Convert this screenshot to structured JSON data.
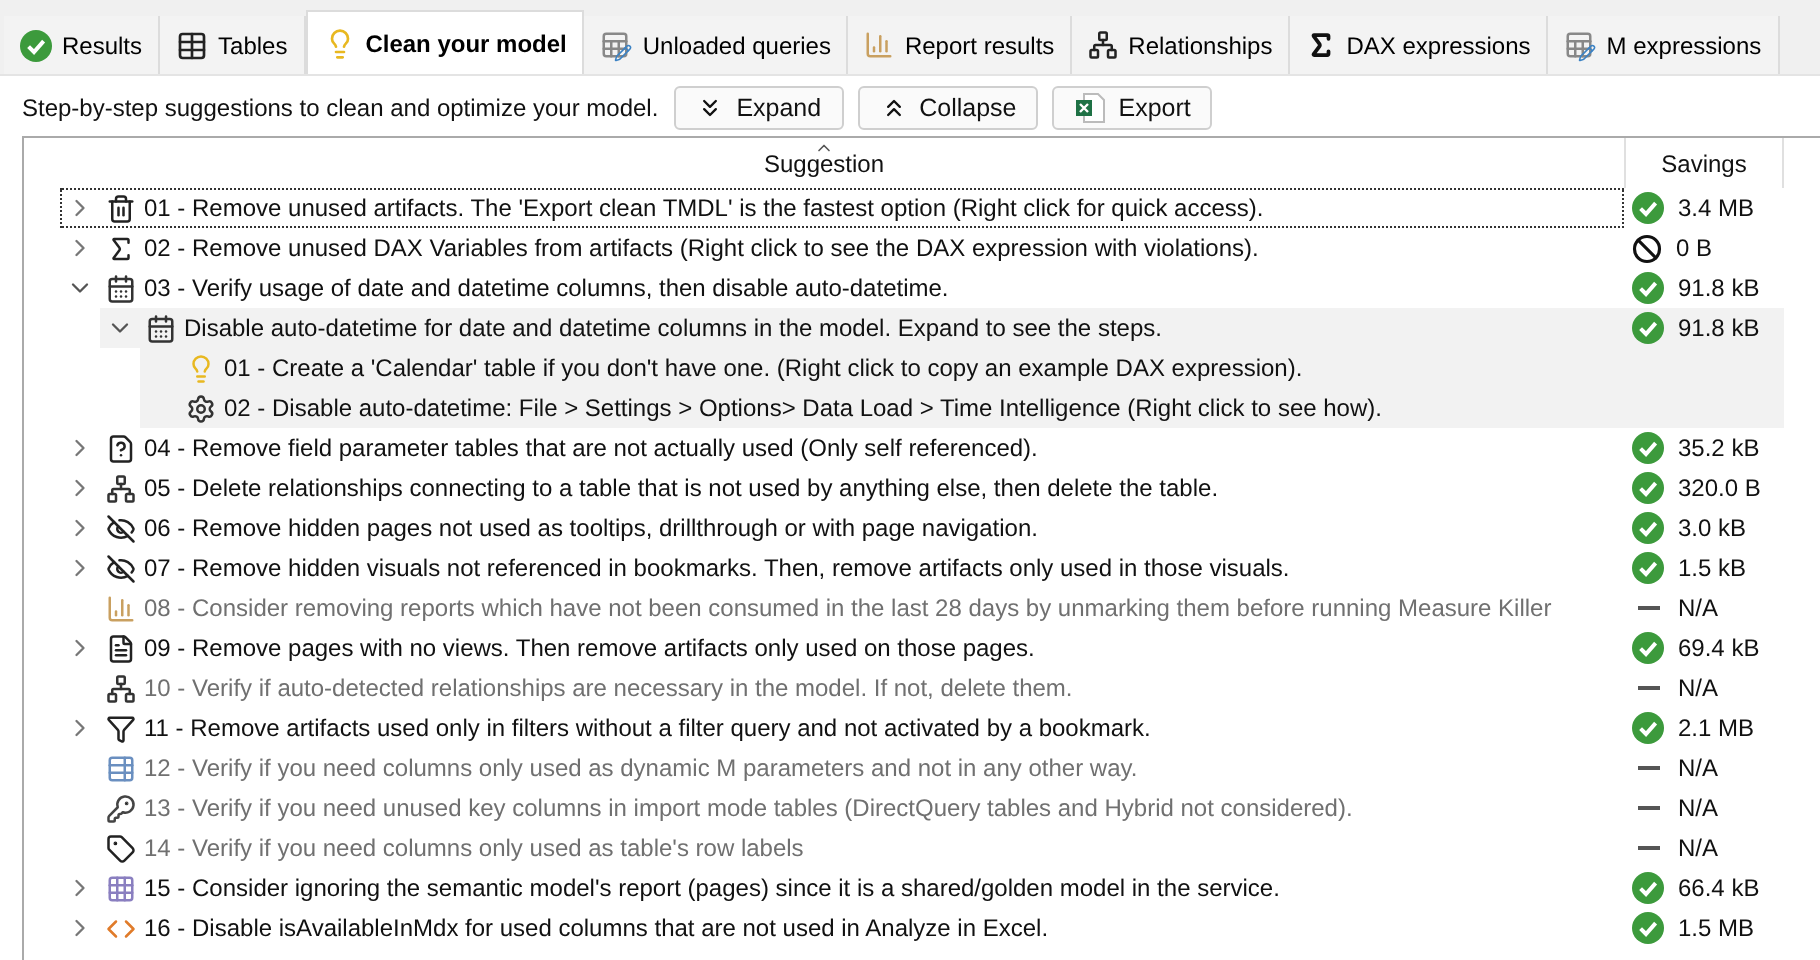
{
  "tabs": [
    {
      "label": "Results",
      "selected": false
    },
    {
      "label": "Tables",
      "selected": false
    },
    {
      "label": "Clean your model",
      "selected": true
    },
    {
      "label": "Unloaded queries",
      "selected": false
    },
    {
      "label": "Report results",
      "selected": false
    },
    {
      "label": "Relationships",
      "selected": false
    },
    {
      "label": "DAX expressions",
      "selected": false
    },
    {
      "label": "M expressions",
      "selected": false
    }
  ],
  "toolbar": {
    "description": "Step-by-step suggestions to clean and optimize your model.",
    "buttons": [
      {
        "label": "Expand"
      },
      {
        "label": "Collapse"
      },
      {
        "label": "Export"
      }
    ]
  },
  "table": {
    "columns": [
      "Suggestion",
      "Savings"
    ],
    "rows": [
      {
        "kind": "ok",
        "text": "01 - Remove unused artifacts. The 'Export clean TMDL' is the fastest option (Right click for quick access).",
        "savings": "3.4 MB",
        "expandable": true,
        "expanded": false,
        "disabled": false,
        "focused": true,
        "highlighted": false
      },
      {
        "kind": "none",
        "text": "02 - Remove unused DAX Variables from artifacts (Right click to see the DAX expression with violations).",
        "savings": "0 B",
        "expandable": true,
        "expanded": false,
        "disabled": false,
        "focused": false,
        "highlighted": false
      },
      {
        "kind": "ok",
        "text": "03 - Verify usage of date and datetime columns, then disable auto-datetime.",
        "savings": "91.8 kB",
        "expandable": true,
        "expanded": true,
        "disabled": false,
        "focused": false,
        "highlighted": false,
        "children": [
          {
            "kind": "ok",
            "text": "Disable auto-datetime for date and datetime columns in the model. Expand to see the steps.",
            "savings": "91.8 kB",
            "expandable": true,
            "expanded": true,
            "disabled": false,
            "focused": false,
            "highlighted": true,
            "children": [
              {
                "text": "01 - Create a 'Calendar' table if you don't have one. (Right click to copy an example DAX expression).",
                "disabled": false,
                "focused": false,
                "highlighted": true
              },
              {
                "text": "02 - Disable auto-datetime: File > Settings > Options> Data Load > Time Intelligence (Right click to see how).",
                "disabled": false,
                "focused": false,
                "highlighted": true
              }
            ]
          }
        ]
      },
      {
        "kind": "ok",
        "text": "04 - Remove field parameter tables that are not actually used (Only self referenced).",
        "savings": "35.2 kB",
        "expandable": true,
        "expanded": false,
        "disabled": false,
        "focused": false,
        "highlighted": false
      },
      {
        "kind": "ok",
        "text": "05 - Delete relationships connecting to a table that is not used by anything else, then delete the table.",
        "savings": "320.0 B",
        "expandable": true,
        "expanded": false,
        "disabled": false,
        "focused": false,
        "highlighted": false
      },
      {
        "kind": "ok",
        "text": "06 - Remove hidden pages not used as tooltips, drillthrough or with page navigation.",
        "savings": "3.0 kB",
        "expandable": true,
        "expanded": false,
        "disabled": false,
        "focused": false,
        "highlighted": false
      },
      {
        "kind": "ok",
        "text": "07 - Remove hidden visuals not referenced in bookmarks. Then, remove artifacts only used in those visuals.",
        "savings": "1.5 kB",
        "expandable": true,
        "expanded": false,
        "disabled": false,
        "focused": false,
        "highlighted": false
      },
      {
        "kind": "na",
        "text": "08 - Consider removing reports which have not been consumed in the last 28 days by unmarking them before running Measure Killer",
        "savings": "N/A",
        "expandable": false,
        "disabled": true,
        "focused": false,
        "highlighted": false
      },
      {
        "kind": "ok",
        "text": "09 - Remove pages with no views. Then remove artifacts only used on those pages.",
        "savings": "69.4 kB",
        "expandable": true,
        "expanded": false,
        "disabled": false,
        "focused": false,
        "highlighted": false
      },
      {
        "kind": "na",
        "text": "10 - Verify if auto-detected relationships are necessary in the model. If not, delete them.",
        "savings": "N/A",
        "expandable": false,
        "disabled": true,
        "focused": false,
        "highlighted": false
      },
      {
        "kind": "ok",
        "text": "11 - Remove artifacts used only in filters without a filter query and not activated by a bookmark.",
        "savings": "2.1 MB",
        "expandable": true,
        "expanded": false,
        "disabled": false,
        "focused": false,
        "highlighted": false
      },
      {
        "kind": "na",
        "text": "12 - Verify if you need columns only used as dynamic M parameters and not in any other way.",
        "savings": "N/A",
        "expandable": false,
        "disabled": true,
        "focused": false,
        "highlighted": false
      },
      {
        "kind": "na",
        "text": "13 - Verify if you need unused key columns in import mode tables (DirectQuery tables and Hybrid not considered).",
        "savings": "N/A",
        "expandable": false,
        "disabled": true,
        "focused": false,
        "highlighted": false
      },
      {
        "kind": "na",
        "text": "14 - Verify if you need columns only used as table's row labels",
        "savings": "N/A",
        "expandable": false,
        "disabled": true,
        "focused": false,
        "highlighted": false
      },
      {
        "kind": "ok",
        "text": "15 - Consider ignoring the semantic model's report (pages) since it is a shared/golden model in the service.",
        "savings": "66.4 kB",
        "expandable": true,
        "expanded": false,
        "disabled": false,
        "focused": false,
        "highlighted": false
      },
      {
        "kind": "ok",
        "text": "16 - Disable isAvailableInMdx for used columns that are not used in Analyze in Excel.",
        "savings": "1.5 MB",
        "expandable": true,
        "expanded": false,
        "disabled": false,
        "focused": false,
        "highlighted": false
      }
    ]
  }
}
